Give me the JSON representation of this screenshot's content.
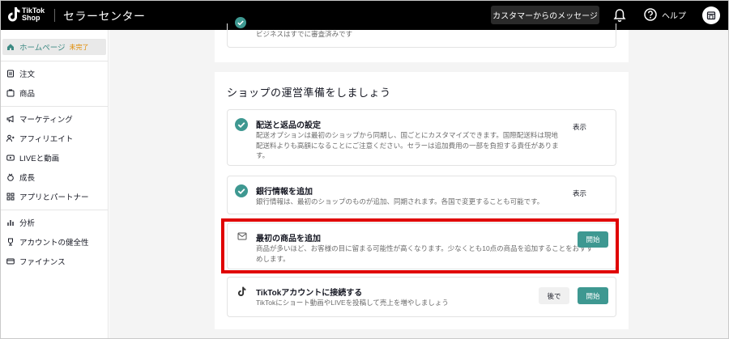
{
  "header": {
    "logo_line1": "TikTok",
    "logo_line2": "Shop",
    "title": "セラーセンター",
    "messages_button": "カスタマーからのメッセージ",
    "help_label": "ヘルプ"
  },
  "sidebar": {
    "home": {
      "label": "ホームページ",
      "badge": "未完了"
    },
    "items": [
      {
        "label": "注文",
        "icon": "order-icon"
      },
      {
        "label": "商品",
        "icon": "product-icon"
      },
      {
        "label": "マーケティング",
        "icon": "megaphone-icon"
      },
      {
        "label": "アフィリエイト",
        "icon": "affiliate-icon"
      },
      {
        "label": "LIVEと動画",
        "icon": "video-icon"
      },
      {
        "label": "成長",
        "icon": "growth-icon"
      },
      {
        "label": "アプリとパートナー",
        "icon": "apps-icon"
      },
      {
        "label": "分析",
        "icon": "analytics-icon"
      },
      {
        "label": "アカウントの健全性",
        "icon": "trophy-icon"
      },
      {
        "label": "ファイナンス",
        "icon": "finance-icon"
      }
    ]
  },
  "main": {
    "prev_card_text": "ビジネスはすでに審査済みです",
    "section_title": "ショップの運営準備をしましょう",
    "tasks": [
      {
        "title": "配送と返品の設定",
        "description": "配送オプションは最初のショップから同期し、国ごとにカスタマイズできます。国際配送料は現地配送料よりも高額になることにご注意ください。セラーは追加費用の一部を負担する責任があります。",
        "action": "表示"
      },
      {
        "title": "銀行情報を追加",
        "description": "銀行情報は、最初のショップのものが追加、同期されます。各国で変更することも可能です。",
        "action": "表示"
      },
      {
        "title": "最初の商品を追加",
        "description": "商品が多いほど、お客様の目に留まる可能性が高くなります。少なくとも10点の商品を追加することをおすすめします。",
        "action": "開始"
      },
      {
        "title": "TikTokアカウントに接続する",
        "description": "TikTokにショート動画やLIVEを投稿して売上を増やしましょう",
        "secondary_action": "後で",
        "action": "開始"
      }
    ]
  },
  "colors": {
    "accent": "#3e9891",
    "highlight": "#e00000",
    "topbar": "#000000"
  }
}
